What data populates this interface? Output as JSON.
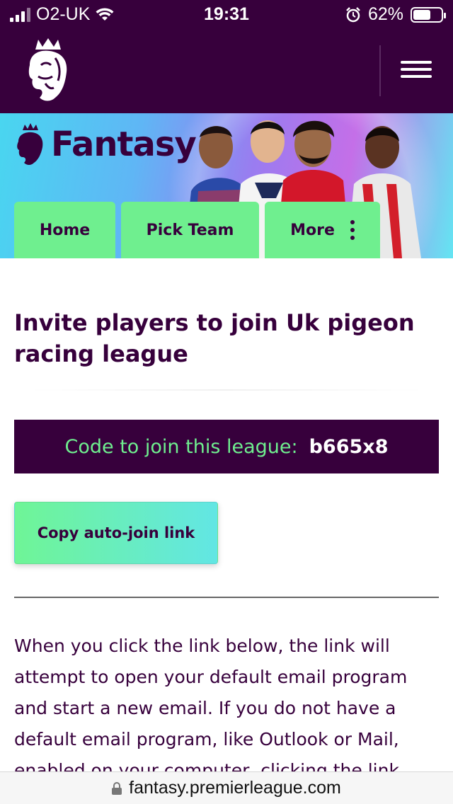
{
  "status_bar": {
    "carrier": "O2-UK",
    "time": "19:31",
    "battery": "62%",
    "battery_level": 0.62,
    "icons": [
      "signal-icon",
      "wifi-icon",
      "alarm-icon",
      "battery-icon"
    ]
  },
  "header": {
    "logo": "premier-league-lion-logo",
    "menu_icon": "hamburger-menu-icon"
  },
  "banner": {
    "brand": "Fantasy",
    "tabs": [
      {
        "label": "Home"
      },
      {
        "label": "Pick Team"
      },
      {
        "label": "More"
      }
    ]
  },
  "main": {
    "title": "Invite players to join Uk pigeon racing league",
    "code_label": "Code to join this league:",
    "code_value": "b665x8",
    "copy_button": "Copy auto-join link",
    "info_text": "When you click the link below, the link will attempt to open your default email program and start a new email. If you do not have a default email program, like Outlook or Mail, enabled on your computer, clicking the link"
  },
  "url_bar": {
    "url": "fantasy.premierleague.com"
  },
  "colors": {
    "brand_purple": "#37003c",
    "accent_green": "#6fef8f",
    "accent_cyan": "#62e6e4"
  }
}
